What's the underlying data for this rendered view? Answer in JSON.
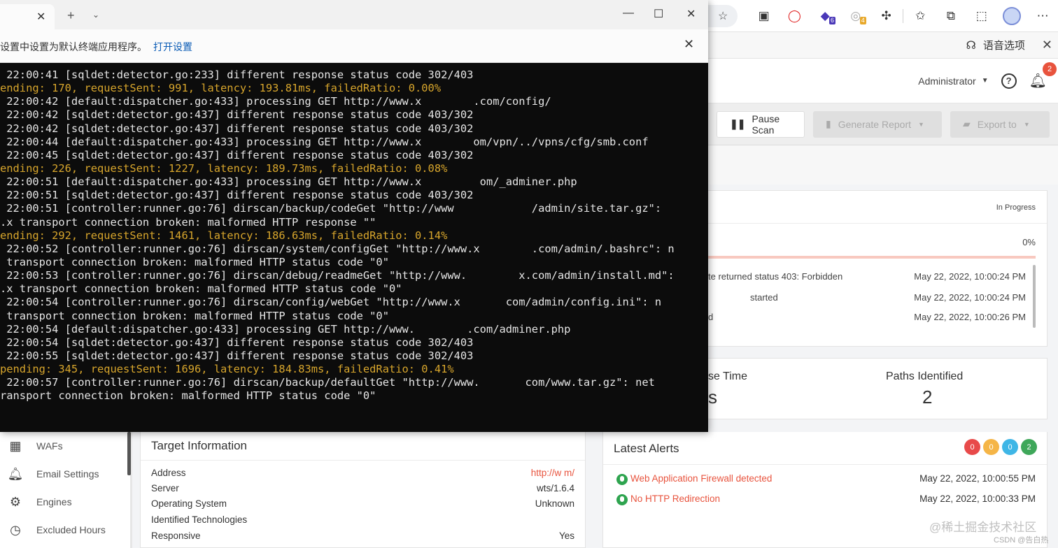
{
  "terminal": {
    "tab_close": "✕",
    "tab_add": "+",
    "tab_dropdown": "⌄",
    "win_minimize": "—",
    "win_maximize": "☐",
    "win_close": "✕",
    "notice_text": "设置中设置为默认终端应用程序。",
    "notice_link": "打开设置",
    "notice_close": "✕",
    "lines": [
      {
        "text": " 22:00:41 [sqldet:detector.go:233] different response status code 302/403",
        "kind": "log"
      },
      {
        "text": "ending: 170, requestSent: 991, latency: 193.81ms, failedRatio: 0.00%",
        "kind": "status"
      },
      {
        "text": " 22:00:42 [default:dispatcher.go:433] processing GET http://www.x        .com/config/",
        "kind": "log"
      },
      {
        "text": " 22:00:42 [sqldet:detector.go:437] different response status code 403/302",
        "kind": "log"
      },
      {
        "text": " 22:00:42 [sqldet:detector.go:437] different response status code 403/302",
        "kind": "log"
      },
      {
        "text": " 22:00:44 [default:dispatcher.go:433] processing GET http://www.x        om/vpn/../vpns/cfg/smb.conf",
        "kind": "log"
      },
      {
        "text": " 22:00:45 [sqldet:detector.go:437] different response status code 403/302",
        "kind": "log"
      },
      {
        "text": "ending: 226, requestSent: 1227, latency: 189.73ms, failedRatio: 0.08%",
        "kind": "status"
      },
      {
        "text": " 22:00:51 [default:dispatcher.go:433] processing GET http://www.x         om/_adminer.php",
        "kind": "log"
      },
      {
        "text": " 22:00:51 [sqldet:detector.go:437] different response status code 403/302",
        "kind": "log"
      },
      {
        "text": " 22:00:51 [controller:runner.go:76] dirscan/backup/codeGet \"http://www            /admin/site.tar.gz\":",
        "kind": "log"
      },
      {
        "text": ".x transport connection broken: malformed HTTP response \"\"",
        "kind": "log"
      },
      {
        "text": "ending: 292, requestSent: 1461, latency: 186.63ms, failedRatio: 0.14%",
        "kind": "status"
      },
      {
        "text": " 22:00:52 [controller:runner.go:76] dirscan/system/configGet \"http://www.x        .com/admin/.bashrc\": n",
        "kind": "log"
      },
      {
        "text": " transport connection broken: malformed HTTP status code \"0\"",
        "kind": "log"
      },
      {
        "text": " 22:00:53 [controller:runner.go:76] dirscan/debug/readmeGet \"http://www.        x.com/admin/install.md\":",
        "kind": "log"
      },
      {
        "text": ".x transport connection broken: malformed HTTP status code \"0\"",
        "kind": "log"
      },
      {
        "text": " 22:00:54 [controller:runner.go:76] dirscan/config/webGet \"http://www.x       com/admin/config.ini\": n",
        "kind": "log"
      },
      {
        "text": " transport connection broken: malformed HTTP status code \"0\"",
        "kind": "log"
      },
      {
        "text": " 22:00:54 [default:dispatcher.go:433] processing GET http://www.        .com/adminer.php",
        "kind": "log"
      },
      {
        "text": " 22:00:54 [sqldet:detector.go:437] different response status code 302/403",
        "kind": "log"
      },
      {
        "text": " 22:00:55 [sqldet:detector.go:437] different response status code 302/403",
        "kind": "log"
      },
      {
        "text": "pending: 345, requestSent: 1696, latency: 184.83ms, failedRatio: 0.41%",
        "kind": "status"
      },
      {
        "text": " 22:00:57 [controller:runner.go:76] dirscan/backup/defaultGet \"http://www.       com/www.tar.gz\": net",
        "kind": "log"
      },
      {
        "text": "ransport connection broken: malformed HTTP status code \"0\"",
        "kind": "log"
      }
    ]
  },
  "browser": {
    "extension_badges": {
      "ext3": "6",
      "ext4": "4"
    },
    "speech_options": "语音选项"
  },
  "header": {
    "user": "Administrator",
    "notification_count": "2"
  },
  "toolbar": {
    "pause_label": "Pause Scan",
    "generate_label": "Generate Report",
    "export_label": "Export to"
  },
  "scan": {
    "status": "In Progress",
    "progress_label": "0%",
    "progress_value": 0.0,
    "events": [
      {
        "text": "te returned status 403: Forbidden",
        "time": "May 22, 2022, 10:00:24 PM"
      },
      {
        "text": "started",
        "time": "May 22, 2022, 10:00:24 PM"
      },
      {
        "text": "d",
        "time": "May 22, 2022, 10:00:26 PM"
      }
    ],
    "stat_time_label": "se Time",
    "stat_time_value": "s",
    "stat_paths_label": "Paths Identified",
    "stat_paths_value": "2"
  },
  "sidebar": {
    "items": [
      {
        "label": "WAFs",
        "icon": "firewall-icon"
      },
      {
        "label": "Email Settings",
        "icon": "bell-icon"
      },
      {
        "label": "Engines",
        "icon": "chip-icon"
      },
      {
        "label": "Excluded Hours",
        "icon": "clock-icon"
      }
    ]
  },
  "target_info": {
    "title": "Target Information",
    "rows": [
      {
        "key": "Address",
        "value": "http://w               m/"
      },
      {
        "key": "Server",
        "value": "wts/1.6.4"
      },
      {
        "key": "Operating System",
        "value": "Unknown"
      },
      {
        "key": "Identified Technologies",
        "value": ""
      },
      {
        "key": "Responsive",
        "value": "Yes"
      }
    ]
  },
  "alerts": {
    "title": "Latest Alerts",
    "severity_counts": [
      {
        "value": "0",
        "color": "#e84a4a"
      },
      {
        "value": "0",
        "color": "#f5b547"
      },
      {
        "value": "0",
        "color": "#3fb6e6"
      },
      {
        "value": "2",
        "color": "#3fa75a"
      }
    ],
    "items": [
      {
        "name": "Web Application Firewall detected",
        "time": "May 22, 2022, 10:00:55 PM"
      },
      {
        "name": "No HTTP Redirection",
        "time": "May 22, 2022, 10:00:33 PM"
      }
    ]
  },
  "watermark": {
    "main": "@稀土掘金技术社区",
    "sub": "CSDN @告白热"
  }
}
